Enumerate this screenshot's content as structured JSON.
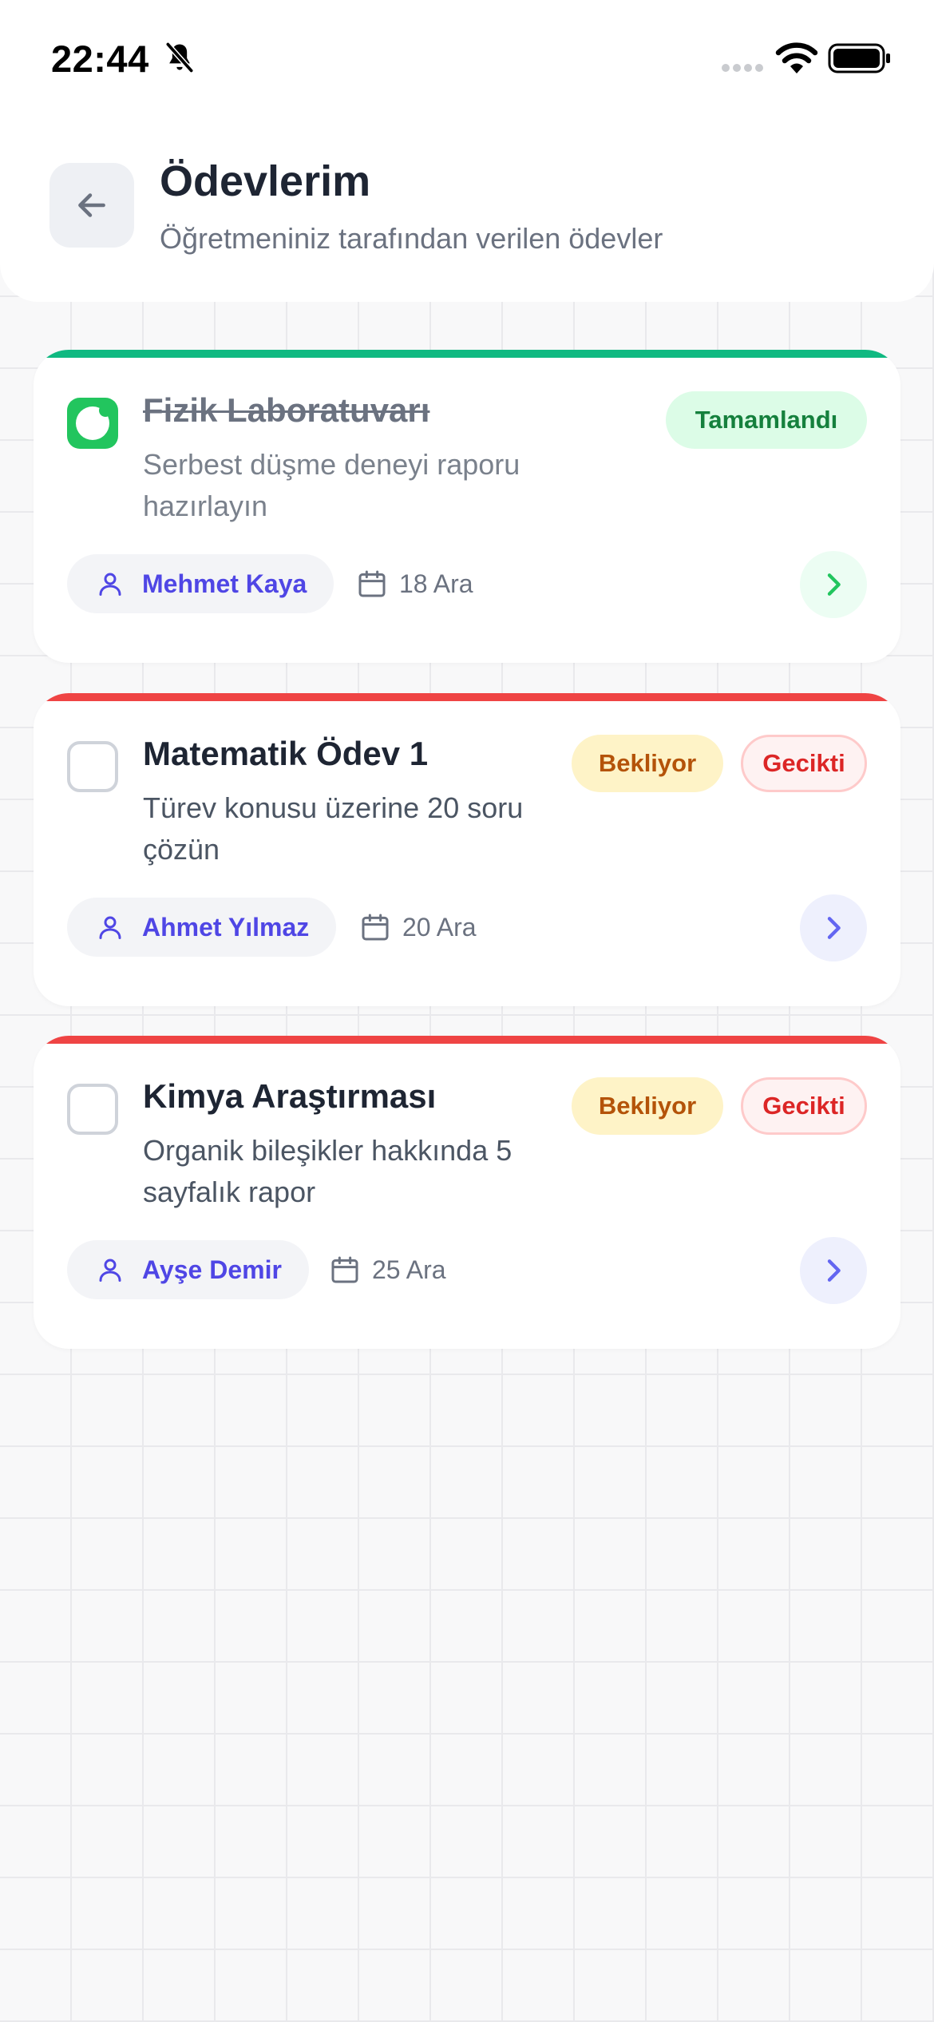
{
  "status_bar": {
    "time": "22:44"
  },
  "header": {
    "title": "Ödevlerim",
    "subtitle": "Öğretmeniniz tarafından verilen ödevler"
  },
  "colors": {
    "completed_accent": "#10b981",
    "late_accent": "#ef4444",
    "teacher_text": "#4f46e5"
  },
  "assignments": [
    {
      "title": "Fizik Laboratuvarı",
      "description": "Serbest düşme deneyi raporu hazırlayın",
      "completed": true,
      "status_badge": "Tamamlandı",
      "teacher": "Mehmet Kaya",
      "due_date": "18 Ara"
    },
    {
      "title": "Matematik Ödev 1",
      "description": "Türev konusu üzerine 20 soru çözün",
      "completed": false,
      "status_badge": "Bekliyor",
      "late_badge": "Gecikti",
      "teacher": "Ahmet Yılmaz",
      "due_date": "20 Ara"
    },
    {
      "title": "Kimya Araştırması",
      "description": "Organik bileşikler hakkında 5 sayfalık rapor",
      "completed": false,
      "status_badge": "Bekliyor",
      "late_badge": "Gecikti",
      "teacher": "Ayşe Demir",
      "due_date": "25 Ara"
    }
  ],
  "icons": {
    "back": "arrow-left-icon",
    "teacher": "person-icon",
    "date": "calendar-icon",
    "open": "chevron-right-icon",
    "silent": "bell-slash-icon"
  }
}
